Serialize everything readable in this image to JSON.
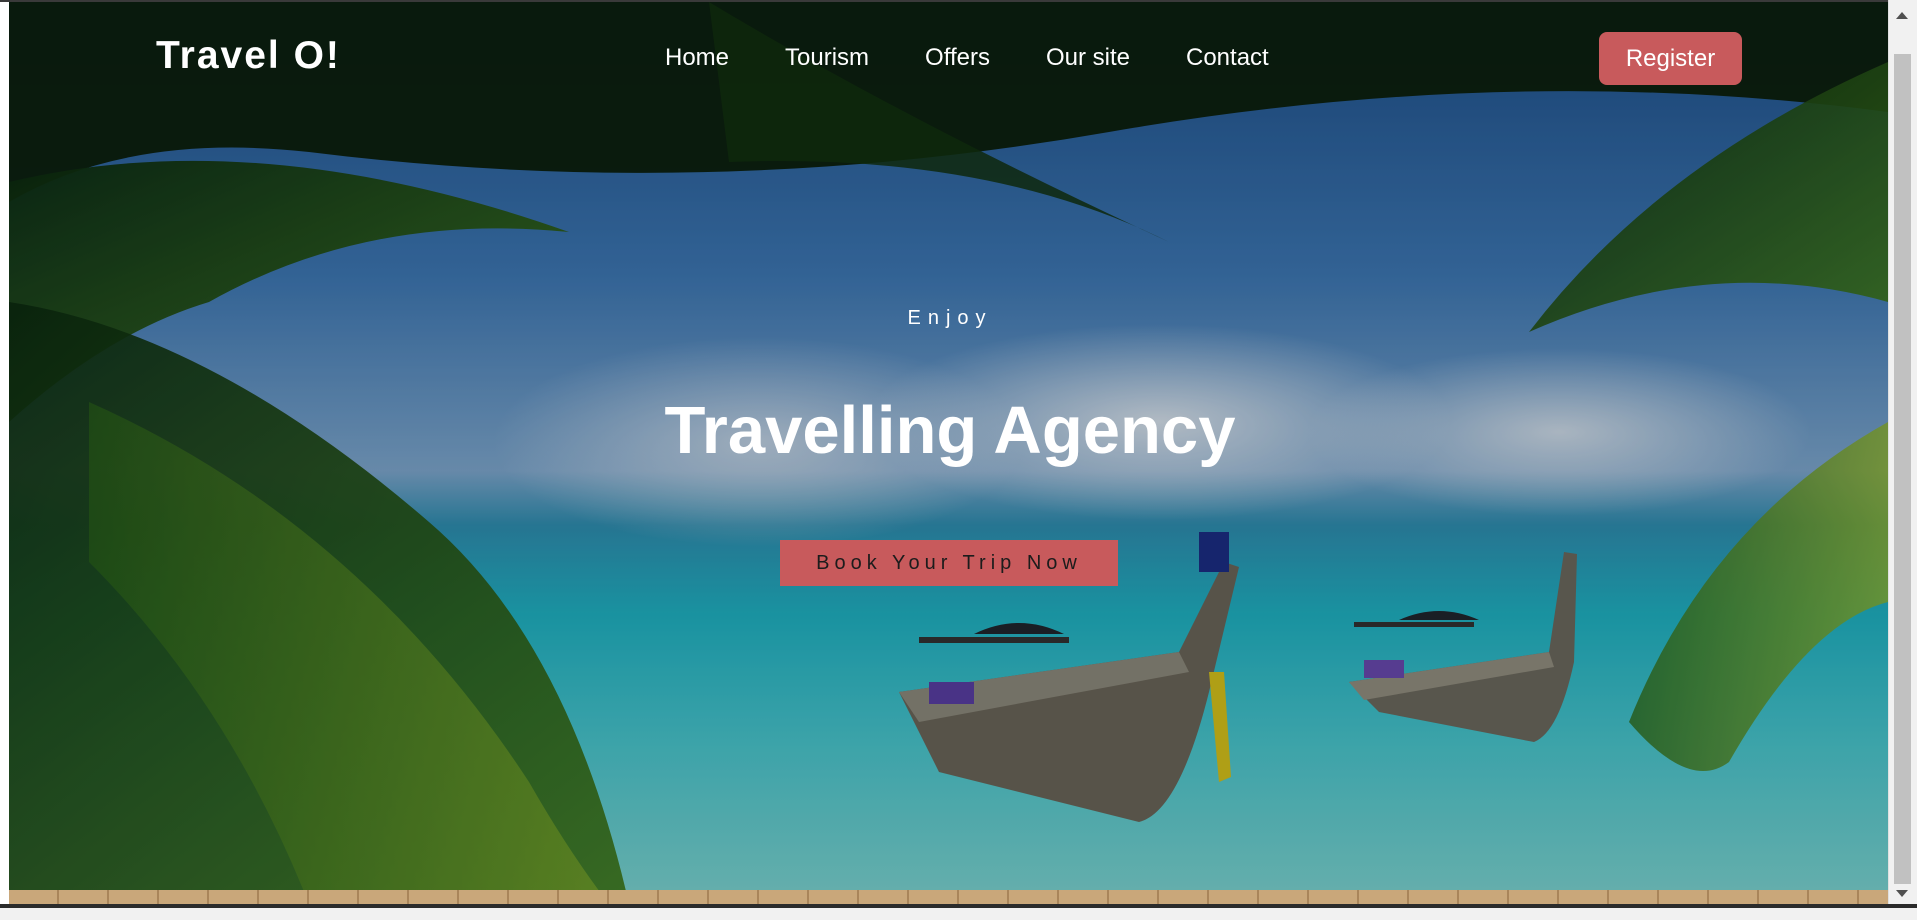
{
  "brand": {
    "name": "Travel O!"
  },
  "nav": {
    "items": [
      "Home",
      "Tourism",
      "Offers",
      "Our site",
      "Contact"
    ]
  },
  "header": {
    "register_label": "Register"
  },
  "hero": {
    "eyebrow": "Enjoy",
    "title": "Travelling Agency",
    "cta_label": "Book Your Trip Now"
  },
  "colors": {
    "accent": "#c85a5c",
    "text_light": "#ffffff",
    "cta_text": "#1c1c1c"
  }
}
